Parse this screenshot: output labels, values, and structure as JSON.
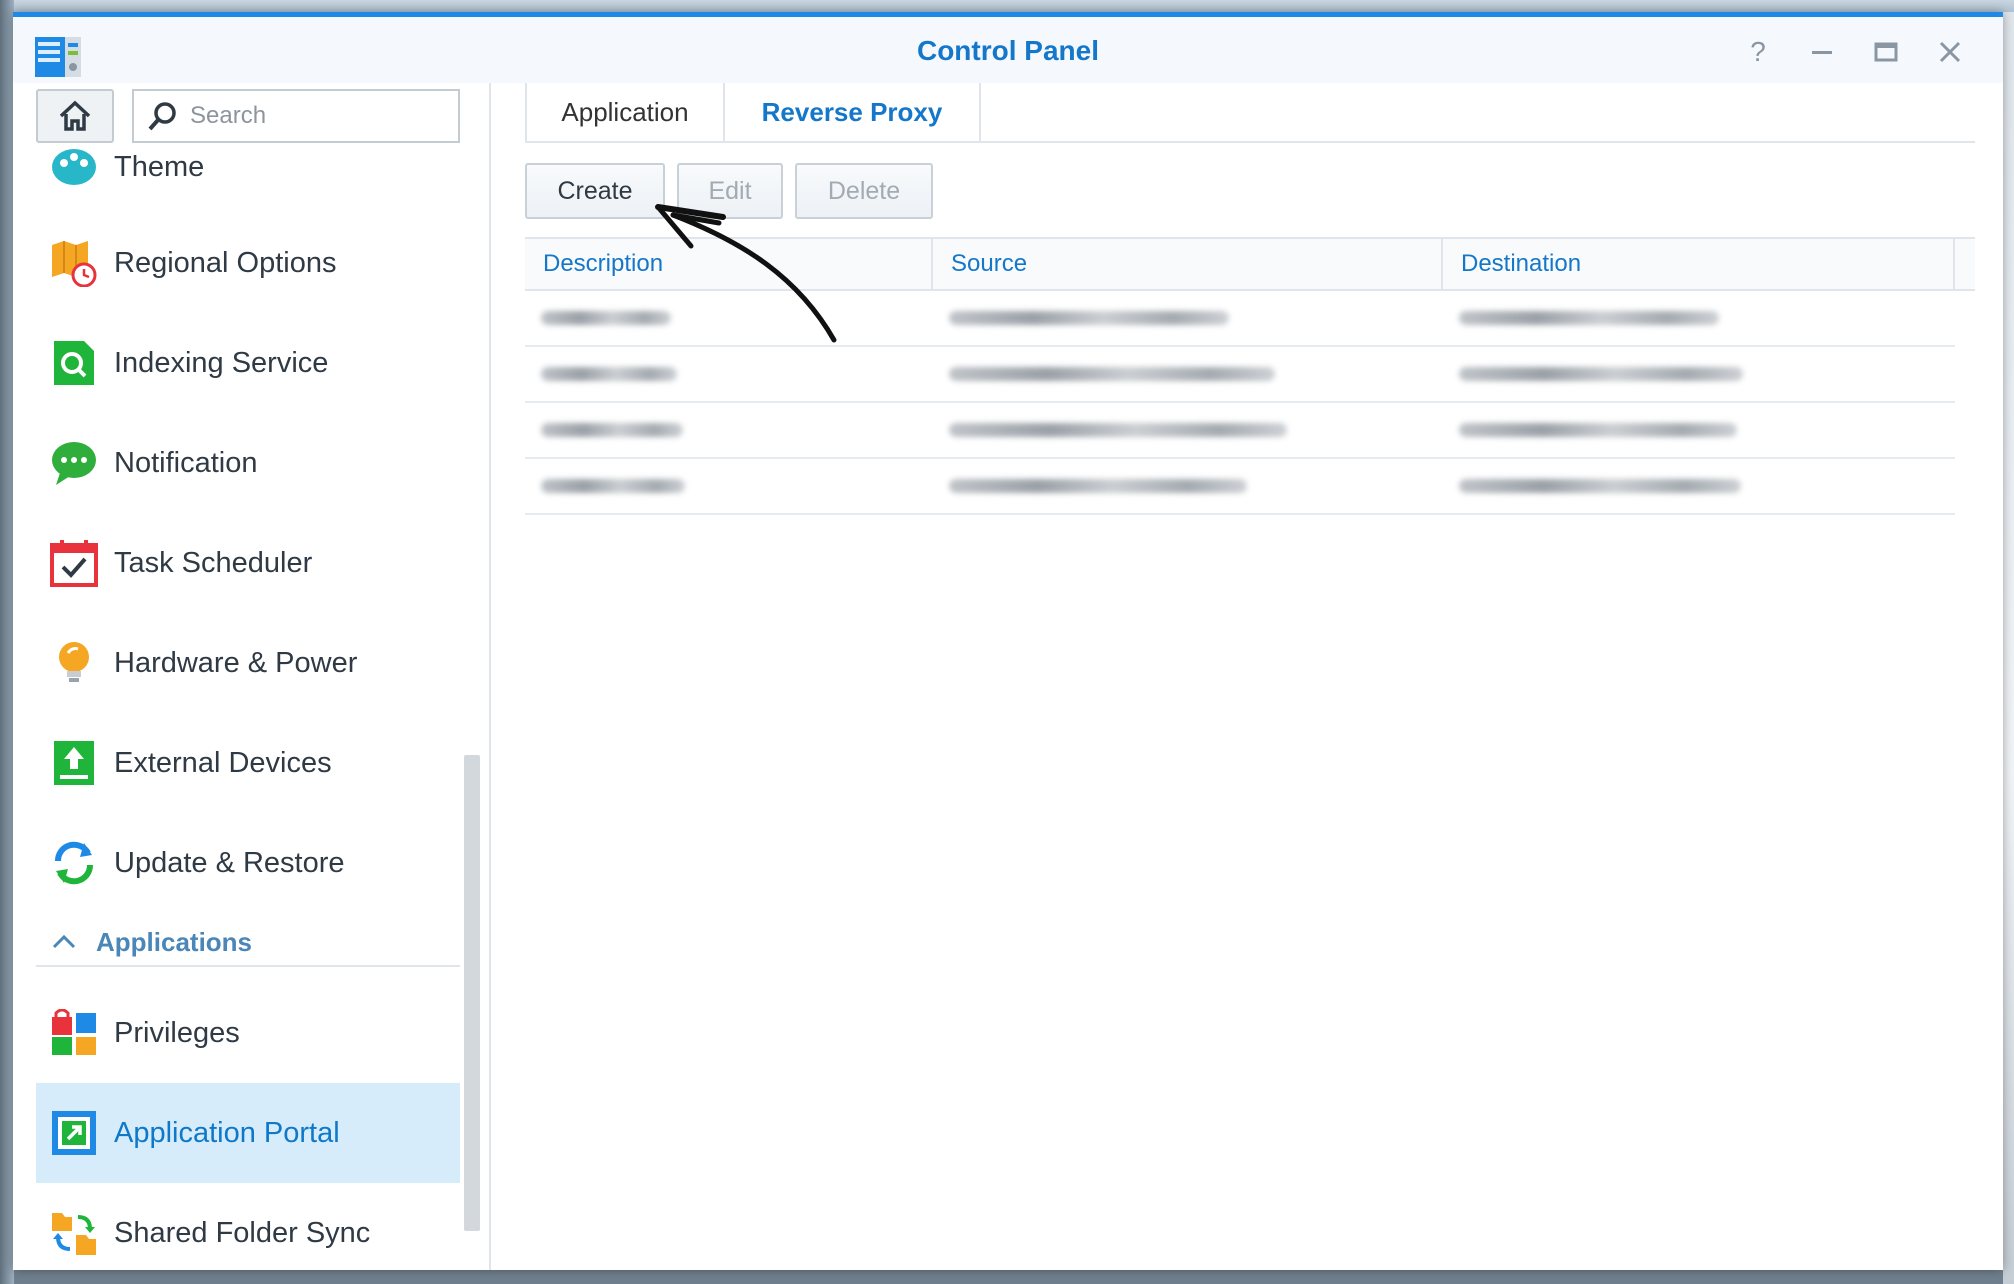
{
  "window": {
    "title": "Control Panel",
    "controls": {
      "help": "?",
      "minimize": "—",
      "maximize": "☐",
      "close": "✕"
    }
  },
  "sidebar": {
    "search_placeholder": "Search",
    "items": [
      {
        "label": "Theme",
        "icon": "theme-icon"
      },
      {
        "label": "Regional Options",
        "icon": "regional-options-icon"
      },
      {
        "label": "Indexing Service",
        "icon": "indexing-service-icon"
      },
      {
        "label": "Notification",
        "icon": "notification-icon"
      },
      {
        "label": "Task Scheduler",
        "icon": "task-scheduler-icon"
      },
      {
        "label": "Hardware & Power",
        "icon": "hardware-power-icon"
      },
      {
        "label": "External Devices",
        "icon": "external-devices-icon"
      },
      {
        "label": "Update & Restore",
        "icon": "update-restore-icon"
      }
    ],
    "section": {
      "label": "Applications",
      "icon": "chevron-up-icon"
    },
    "app_items": [
      {
        "label": "Privileges",
        "icon": "privileges-icon"
      },
      {
        "label": "Application Portal",
        "icon": "application-portal-icon",
        "active": true
      },
      {
        "label": "Shared Folder Sync",
        "icon": "shared-folder-sync-icon"
      }
    ]
  },
  "main": {
    "tabs": [
      {
        "label": "Application",
        "active": false
      },
      {
        "label": "Reverse Proxy",
        "active": true
      }
    ],
    "toolbar": {
      "create": "Create",
      "edit": "Edit",
      "delete": "Delete"
    },
    "table": {
      "columns": [
        "Description",
        "Source",
        "Destination"
      ],
      "rows": [
        {
          "description": "",
          "source": "",
          "destination": ""
        },
        {
          "description": "",
          "source": "",
          "destination": ""
        },
        {
          "description": "",
          "source": "",
          "destination": ""
        },
        {
          "description": "",
          "source": "",
          "destination": ""
        }
      ]
    }
  },
  "colors": {
    "accent": "#1477c9",
    "active_bg": "#d7ecfb",
    "border": "#dfe5ea"
  }
}
